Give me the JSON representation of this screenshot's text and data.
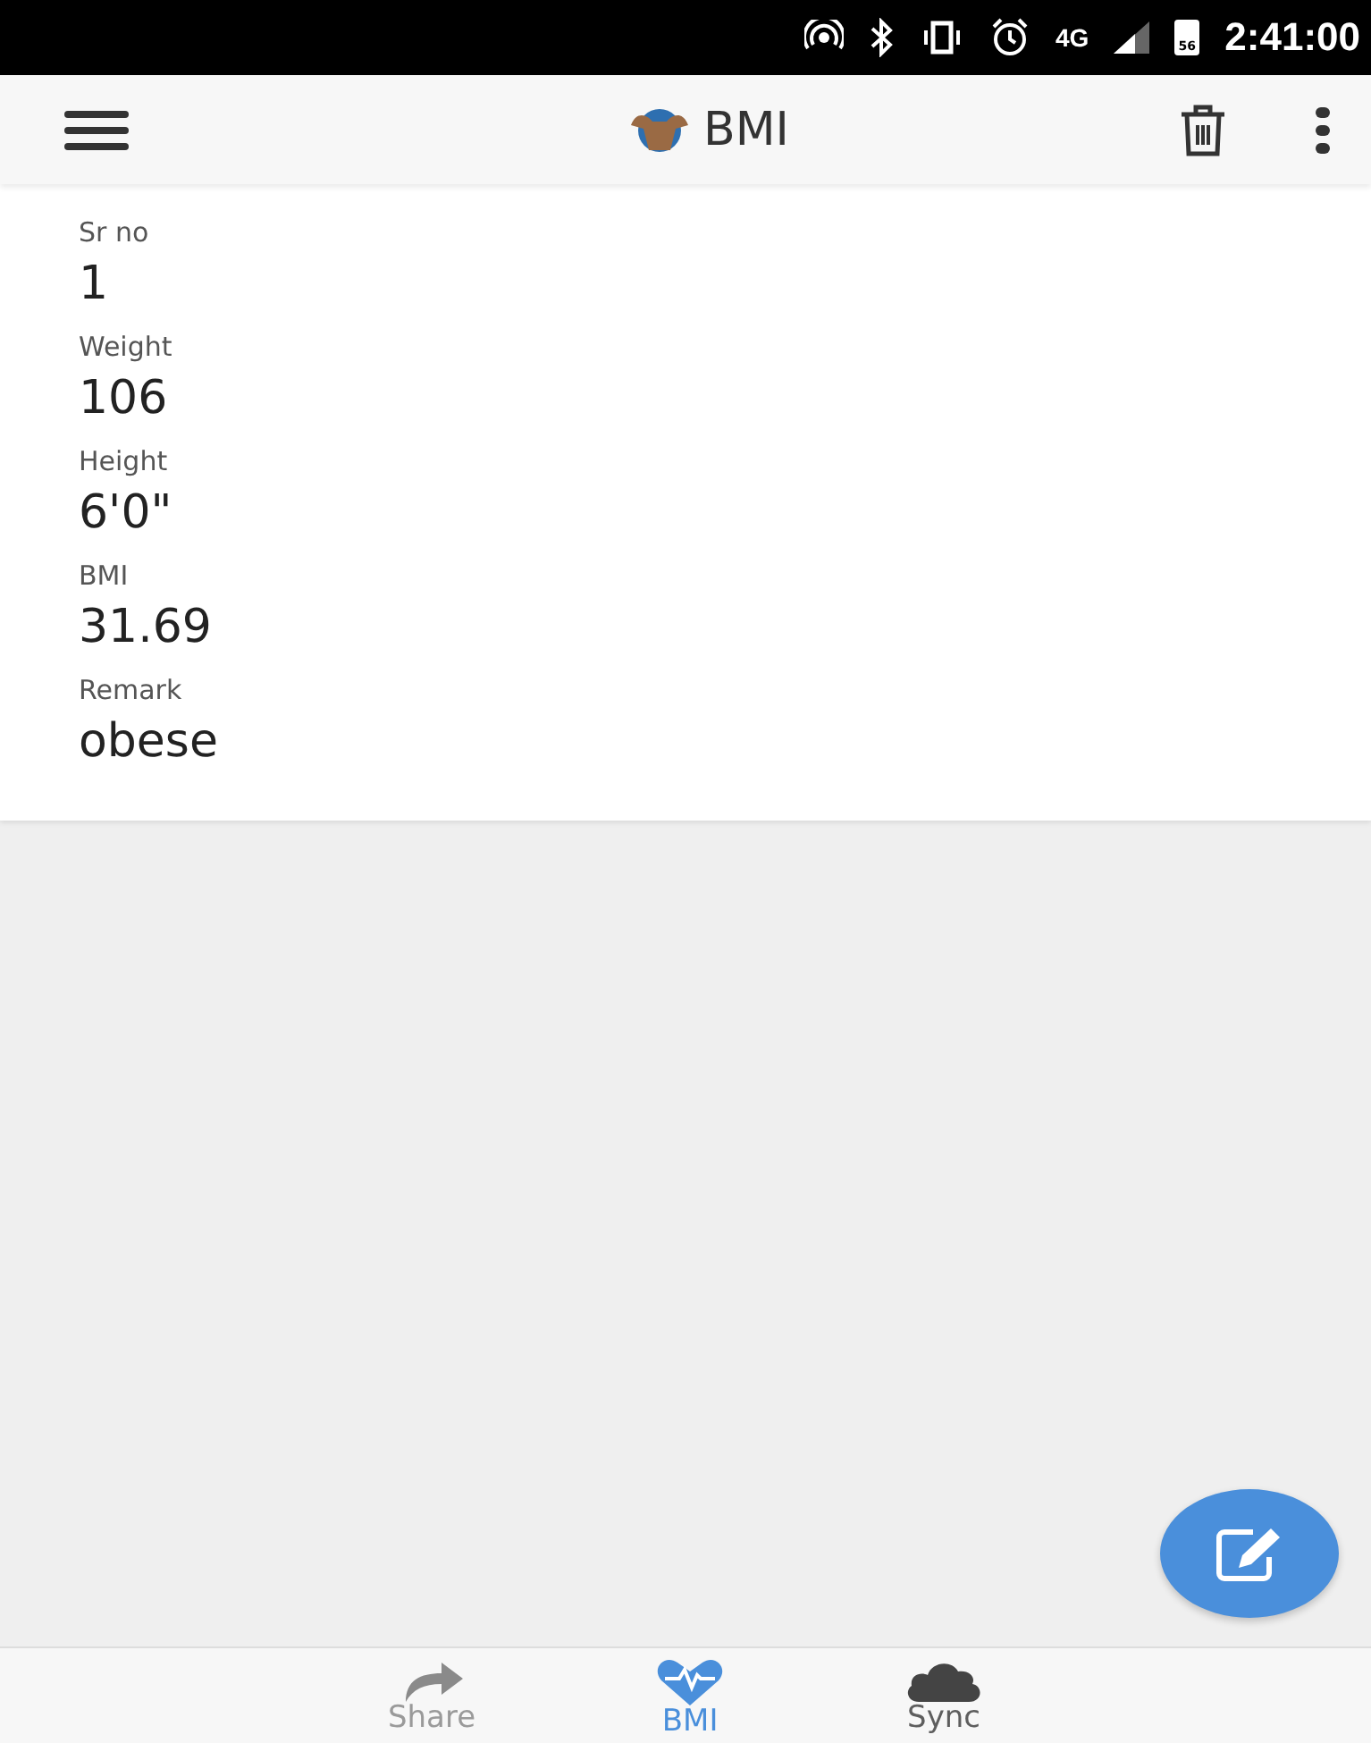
{
  "status_bar": {
    "network": "4G",
    "battery": "56",
    "time": "2:41:00"
  },
  "app_bar": {
    "title": "BMI"
  },
  "record": [
    {
      "label": "Sr no",
      "value": "1"
    },
    {
      "label": "Weight",
      "value": "106"
    },
    {
      "label": "Height",
      "value": "6'0\""
    },
    {
      "label": "BMI",
      "value": "31.69"
    },
    {
      "label": "Remark",
      "value": "obese"
    }
  ],
  "bottom_nav": [
    {
      "kind": "share",
      "label": "Share",
      "selected": false,
      "color": "#8a8a8a"
    },
    {
      "kind": "bmi",
      "label": "BMI",
      "selected": true,
      "color": "#4a8fdb"
    },
    {
      "kind": "sync",
      "label": "Sync",
      "selected": false,
      "color": "#444444"
    }
  ]
}
